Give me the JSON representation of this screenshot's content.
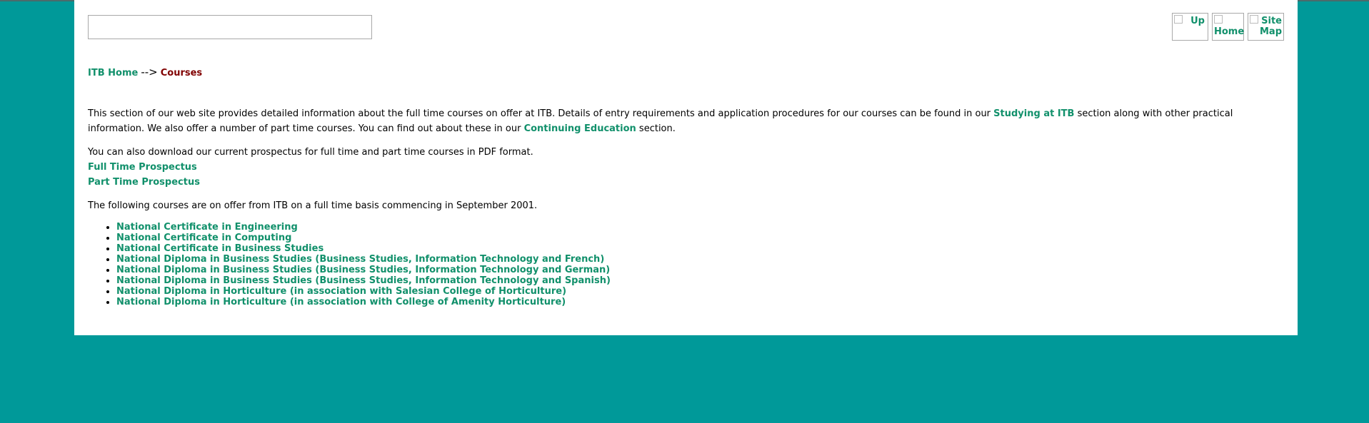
{
  "navigation": {
    "up_label": "Up",
    "home_label": "Home",
    "sitemap_label": "Site Map"
  },
  "breadcrumb": {
    "home": "ITB Home",
    "separator": "-->",
    "current": "Courses"
  },
  "intro": {
    "text1": "This section of our web site provides detailed information about the full time courses on offer at ITB. Details of entry requirements and application procedures for our courses can be found in our ",
    "link1": "Studying at ITB",
    "text2": " section along with other practical information. We also offer a number of part time courses. You can find out about these in our ",
    "link2": "Continuing Education",
    "text3": " section."
  },
  "prospectus": {
    "text": "You can also download our current prospectus for full time and part time courses in PDF format.",
    "full_time": "Full Time Prospectus",
    "part_time": "Part Time Prospectus"
  },
  "courses_intro": "The following courses are on offer from ITB on a full time basis commencing in September 2001.",
  "courses": [
    "National Certificate in Engineering",
    "National Certificate in Computing",
    "National Certificate in Business Studies",
    "National Diploma in Business Studies (Business Studies, Information Technology and French)",
    "National Diploma in Business Studies (Business Studies, Information Technology and German)",
    "National Diploma in Business Studies (Business Studies, Information Technology and Spanish)",
    "National Diploma in Horticulture (in association with Salesian College of Horticulture)",
    "National Diploma in Horticulture (in association with College of Amenity Horticulture)"
  ],
  "colors": {
    "background": "#009999",
    "link": "#11906b",
    "current": "#800000",
    "panel": "#ffffff"
  }
}
